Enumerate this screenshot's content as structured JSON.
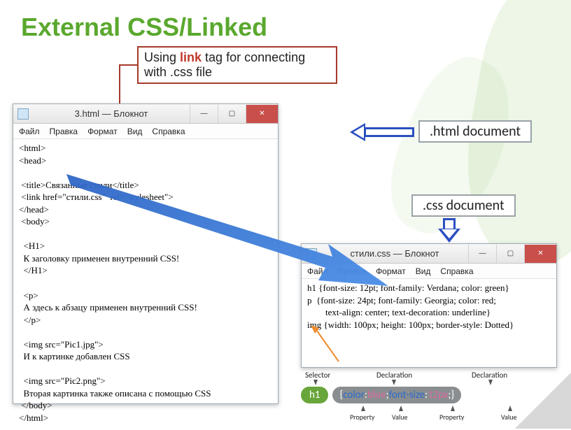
{
  "title": "External CSS/Linked",
  "callout": {
    "before": "Using ",
    "em": "link",
    "after": " tag for connecting with .css file"
  },
  "labels": {
    "html_doc": ".html document",
    "css_doc": ".css document"
  },
  "notepad_common": {
    "menu": [
      "Файл",
      "Правка",
      "Формат",
      "Вид",
      "Справка"
    ],
    "min": "—",
    "max": "▢",
    "close": "✕"
  },
  "np_html": {
    "title": "3.html — Блокнот",
    "body": "<html>\n<head>\n\n <title>Связанные стили</title>\n <link href=\"стили.css\"  rel=\"stylesheet\">\n</head>\n <body>\n\n  <H1>\n  К заголовку применен внутренний CSS!\n  </H1>\n\n  <p>\n  А здесь к абзацу применен внутренний CSS!\n  </p>\n\n  <img src=\"Pic1.jpg\">\n  И к картинке добавлен CSS\n\n  <img src=\"Pic2.png\">\n  Вторая картинка также описана с помощью CSS\n </body>\n</html>"
  },
  "np_css": {
    "title": "стили.css — Блокнот",
    "body": "h1 {font-size: 12pt; font-family: Verdana; color: green}\np  {font-size: 24pt; font-family: Georgia; color: red;\n        text-align: center; text-decoration: underline}\nimg {width: 100px; height: 100px; border-style: Dotted}"
  },
  "syntax": {
    "top": {
      "selector": "Selector",
      "decl1": "Declaration",
      "decl2": "Declaration"
    },
    "selector_pill": "h1",
    "decl_parts": {
      "open": "{",
      "prop1": "color",
      "colon1": ":",
      "val1": "blue",
      "semi1": ";",
      "space": " ",
      "prop2": "font-size",
      "colon2": ":",
      "val2": "12px",
      "semi2": ";",
      "close": "}"
    },
    "bottom": {
      "property": "Property",
      "value": "Value"
    }
  }
}
